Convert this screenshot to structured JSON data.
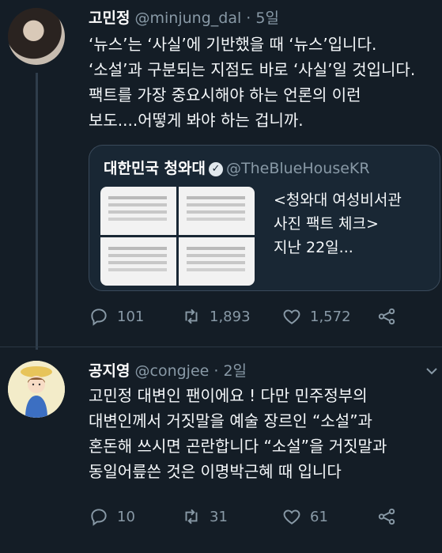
{
  "tweet1": {
    "name": "고민정",
    "handle": "@minjung_dal",
    "time": " · 5일",
    "lines": [
      "‘뉴스’는 ‘사실’에 기반했을 때 ‘뉴스’입니다.",
      "‘소설’과 구분되는 지점도 바로 ‘사실’일 것입니다.",
      "팩트를 가장 중요시해야 하는 언론의 이런",
      "보도....어떻게 봐야 하는 겁니까."
    ],
    "quote": {
      "name": "대한민국 청와대",
      "handle": "@TheBlueHouseKR",
      "text_lines": [
        "<청와대 여성비서관",
        "사진 팩트 체크>",
        "지난 22일..."
      ]
    },
    "counts": {
      "reply": "101",
      "retweet": "1,893",
      "like": "1,572"
    }
  },
  "tweet2": {
    "name": "공지영",
    "handle": "@congjee",
    "time": " · 2일",
    "lines": [
      "고민정 대변인 팬이에요 ! 다만 민주정부의",
      "대변인께서 거짓말을 예술 장르인 “소설”과",
      "혼돈해 쓰시면 곤란합니다 “소설”을 거짓말과",
      "동일어릎쓴 것은 이명박근혜 때 입니다"
    ],
    "counts": {
      "reply": "10",
      "retweet": "31",
      "like": "61"
    }
  },
  "icons": [
    "reply-icon",
    "retweet-icon",
    "like-icon",
    "share-icon",
    "verified-icon",
    "chevron-down-icon"
  ],
  "colors": {
    "background": "#141d26",
    "secondary_text": "#8899a6",
    "card": "#192734"
  }
}
